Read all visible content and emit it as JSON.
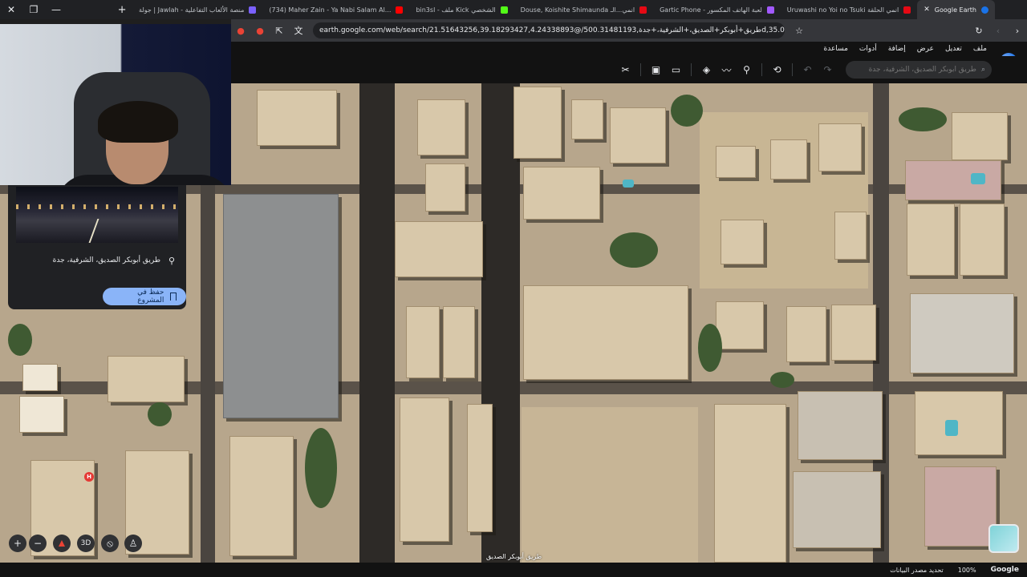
{
  "browser": {
    "tabs": [
      {
        "label": "جولة | Jawlah - منصة الألعاب التفاعلية",
        "fav_color": "#7b61ff"
      },
      {
        "label": "(734) Maher Zain - Ya Nabi Salam Al...",
        "fav_color": "#ff0000"
      },
      {
        "label": "bin3sl - ملف Kick الشخصي",
        "fav_color": "#53fc18"
      },
      {
        "label": "Douse, Koishite Shimaunda انمي...الـ",
        "fav_color": "#e50914"
      },
      {
        "label": "Gartic Phone - لعبة الهاتف المكسور",
        "fav_color": "#a259ff"
      },
      {
        "label": "Uruwashi no Yoi no Tsuki انمي الحلقة",
        "fav_color": "#e50914"
      },
      {
        "label": "Google Earth",
        "fav_color": "#1a73e8"
      }
    ],
    "url": "earth.google.com/web/search/21.51643256,39.18293427,4.24338893@/طريق+أبوبكر+الصديق،+الشرفية،+جدة,500.31481193d,35.00003425y,358..."
  },
  "ge": {
    "menu": [
      "ملف",
      "تعديل",
      "عرض",
      "إضافة",
      "أدوات",
      "مساعدة"
    ],
    "search_placeholder": "طريق أبوبكر الصديق، الشرفية، جدة",
    "card": {
      "location": "طريق أبوبكر الصديق، الشرفية، جدة",
      "save_label": "حفظ في المشروع"
    },
    "map_label": "طريق أبوبكر الصديق",
    "poi_letter": "H",
    "controls": {
      "threed": "3D"
    },
    "status": {
      "data_source": "تحديد مصدر البيانات",
      "zoom": "100%",
      "brand": "Google"
    }
  },
  "icons": [
    "close-icon",
    "maximize-icon",
    "minimize-icon",
    "new-tab-icon",
    "reload-icon",
    "back-icon",
    "forward-icon",
    "bookmark-icon",
    "search-icon",
    "pin-icon",
    "compass-icon",
    "pegman-icon",
    "layers-icon",
    "ruler-icon"
  ]
}
